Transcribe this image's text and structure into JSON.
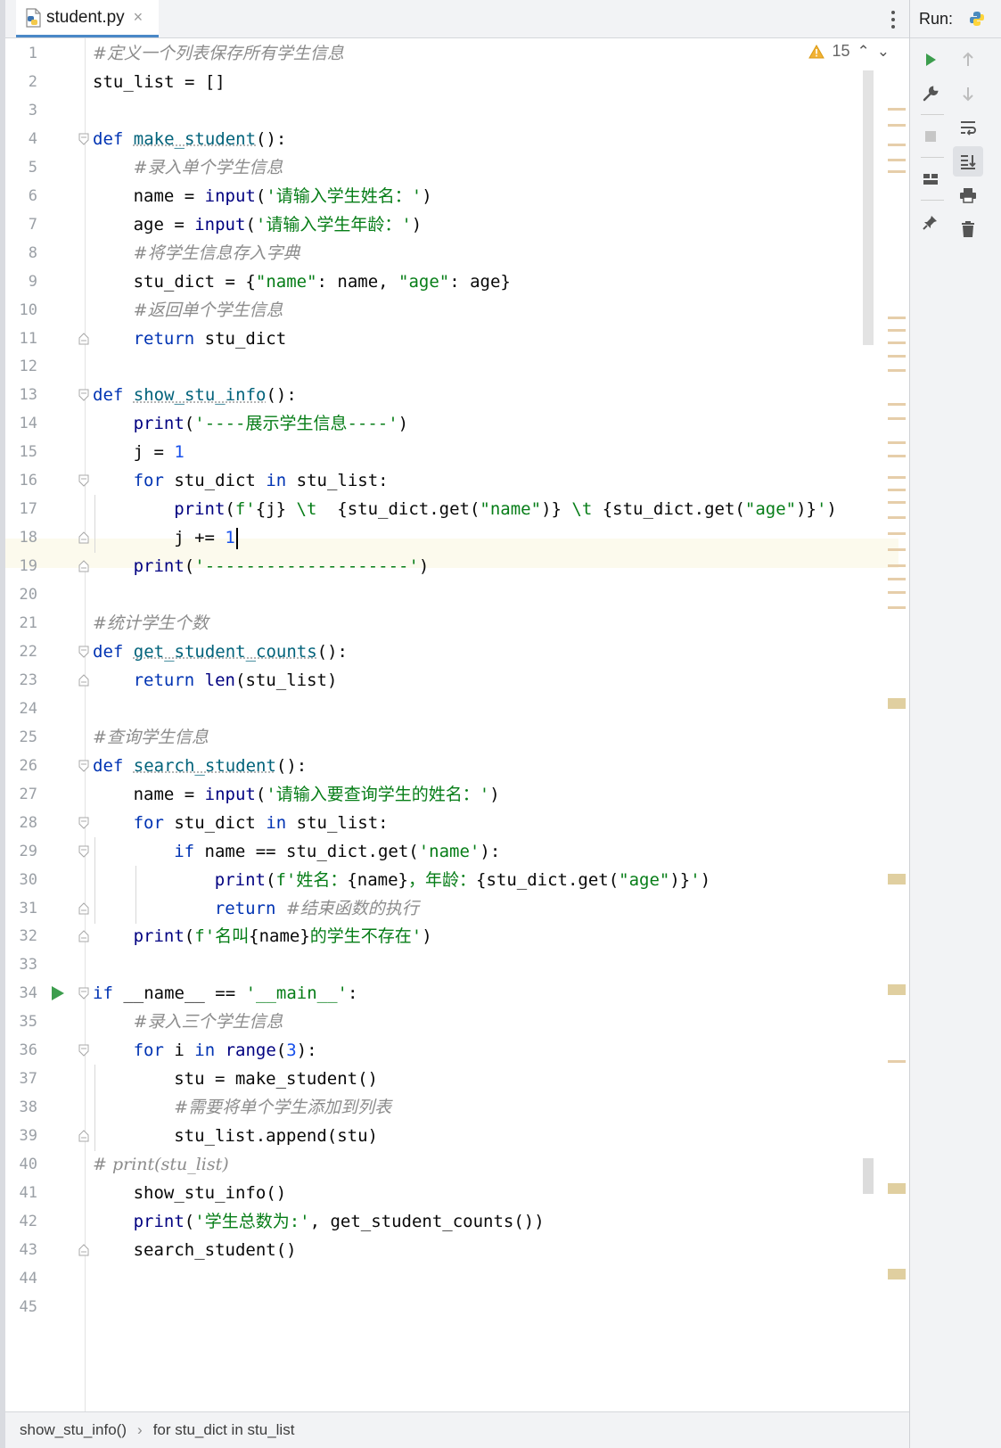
{
  "tab": {
    "filename": "student.py",
    "close_glyph": "×"
  },
  "run_panel": {
    "title": "Run:"
  },
  "inspections": {
    "warning_count": "15",
    "up_glyph": "⌃",
    "down_glyph": "⌄"
  },
  "breadcrumb": {
    "items": [
      "show_stu_info()",
      "for stu_dict in stu_list"
    ],
    "separator": "›"
  },
  "caret_line": 18,
  "colors": {
    "keyword": "#0033b3",
    "function": "#00627a",
    "string": "#067d17",
    "number": "#1750eb",
    "comment": "#8c8c8c",
    "run_green": "#3c9d4d",
    "caret_row": "#fcfaed"
  },
  "icons": [
    "python-file-icon",
    "warning-icon",
    "run-icon",
    "wrench-icon",
    "stop-icon",
    "layout-icon",
    "pin-icon",
    "arrow-up-icon",
    "arrow-down-icon",
    "soft-wrap-icon",
    "scroll-to-end-icon",
    "print-icon",
    "trash-icon",
    "fold-icon",
    "python-logo-icon"
  ],
  "lines": [
    {
      "n": 1,
      "indent": 0,
      "fold": "",
      "segs": [
        [
          "cmt",
          "#定义一个列表保存所有学生信息"
        ]
      ]
    },
    {
      "n": 2,
      "indent": 0,
      "fold": "",
      "segs": [
        [
          "plain",
          "stu_list = []"
        ]
      ]
    },
    {
      "n": 3,
      "indent": 0,
      "fold": "",
      "segs": []
    },
    {
      "n": 4,
      "indent": 0,
      "fold": "open",
      "segs": [
        [
          "kw",
          "def "
        ],
        [
          "fn",
          "make_student"
        ],
        [
          "plain",
          "():"
        ]
      ]
    },
    {
      "n": 5,
      "indent": 1,
      "fold": "",
      "segs": [
        [
          "cmt",
          "#录入单个学生信息"
        ]
      ]
    },
    {
      "n": 6,
      "indent": 1,
      "fold": "",
      "segs": [
        [
          "plain",
          "name = "
        ],
        [
          "bi",
          "input"
        ],
        [
          "plain",
          "("
        ],
        [
          "str",
          "'请输入学生姓名：'"
        ],
        [
          "plain",
          ")"
        ]
      ]
    },
    {
      "n": 7,
      "indent": 1,
      "fold": "",
      "segs": [
        [
          "plain",
          "age = "
        ],
        [
          "bi",
          "input"
        ],
        [
          "plain",
          "("
        ],
        [
          "str",
          "'请输入学生年龄：'"
        ],
        [
          "plain",
          ")"
        ]
      ]
    },
    {
      "n": 8,
      "indent": 1,
      "fold": "",
      "segs": [
        [
          "cmt",
          "#将学生信息存入字典"
        ]
      ]
    },
    {
      "n": 9,
      "indent": 1,
      "fold": "",
      "segs": [
        [
          "plain",
          "stu_dict = {"
        ],
        [
          "str",
          "\"name\""
        ],
        [
          "plain",
          ": name, "
        ],
        [
          "str",
          "\"age\""
        ],
        [
          "plain",
          ": age}"
        ]
      ]
    },
    {
      "n": 10,
      "indent": 1,
      "fold": "",
      "segs": [
        [
          "cmt",
          "#返回单个学生信息"
        ]
      ]
    },
    {
      "n": 11,
      "indent": 1,
      "fold": "close",
      "segs": [
        [
          "kw",
          "return "
        ],
        [
          "plain",
          "stu_dict"
        ]
      ]
    },
    {
      "n": 12,
      "indent": 0,
      "fold": "",
      "segs": []
    },
    {
      "n": 13,
      "indent": 0,
      "fold": "open",
      "segs": [
        [
          "kw",
          "def "
        ],
        [
          "fn",
          "show_stu_info"
        ],
        [
          "plain",
          "():"
        ]
      ]
    },
    {
      "n": 14,
      "indent": 1,
      "fold": "",
      "segs": [
        [
          "bi",
          "print"
        ],
        [
          "plain",
          "("
        ],
        [
          "str",
          "'----展示学生信息----'"
        ],
        [
          "plain",
          ")"
        ]
      ]
    },
    {
      "n": 15,
      "indent": 1,
      "fold": "",
      "segs": [
        [
          "plain",
          "j = "
        ],
        [
          "num",
          "1"
        ]
      ]
    },
    {
      "n": 16,
      "indent": 1,
      "fold": "open",
      "segs": [
        [
          "kw",
          "for "
        ],
        [
          "plain",
          "stu_dict "
        ],
        [
          "kw",
          "in "
        ],
        [
          "plain",
          "stu_list:"
        ]
      ]
    },
    {
      "n": 17,
      "indent": 2,
      "fold": "",
      "segs": [
        [
          "bi",
          "print"
        ],
        [
          "plain",
          "("
        ],
        [
          "str",
          "f'"
        ],
        [
          "plain",
          "{j}"
        ],
        [
          "str",
          " \\t  "
        ],
        [
          "plain",
          "{stu_dict.get("
        ],
        [
          "str",
          "\"name\""
        ],
        [
          "plain",
          ")}"
        ],
        [
          "str",
          " \\t "
        ],
        [
          "plain",
          "{stu_dict.get("
        ],
        [
          "str",
          "\"age\""
        ],
        [
          "plain",
          ")}"
        ],
        [
          "str",
          "'"
        ],
        [
          "plain",
          ")"
        ]
      ]
    },
    {
      "n": 18,
      "indent": 2,
      "fold": "close",
      "segs": [
        [
          "plain",
          "j += "
        ],
        [
          "num",
          "1"
        ]
      ]
    },
    {
      "n": 19,
      "indent": 1,
      "fold": "close",
      "segs": [
        [
          "bi",
          "print"
        ],
        [
          "plain",
          "("
        ],
        [
          "str",
          "'--------------------'"
        ],
        [
          "plain",
          ")"
        ]
      ]
    },
    {
      "n": 20,
      "indent": 0,
      "fold": "",
      "segs": []
    },
    {
      "n": 21,
      "indent": 0,
      "fold": "",
      "segs": [
        [
          "cmt",
          "#统计学生个数"
        ]
      ]
    },
    {
      "n": 22,
      "indent": 0,
      "fold": "open",
      "segs": [
        [
          "kw",
          "def "
        ],
        [
          "fn",
          "get_student_counts"
        ],
        [
          "plain",
          "():"
        ]
      ]
    },
    {
      "n": 23,
      "indent": 1,
      "fold": "close",
      "segs": [
        [
          "kw",
          "return "
        ],
        [
          "bi",
          "len"
        ],
        [
          "plain",
          "(stu_list)"
        ]
      ]
    },
    {
      "n": 24,
      "indent": 0,
      "fold": "",
      "segs": []
    },
    {
      "n": 25,
      "indent": 0,
      "fold": "",
      "segs": [
        [
          "cmt",
          "#查询学生信息"
        ]
      ]
    },
    {
      "n": 26,
      "indent": 0,
      "fold": "open",
      "segs": [
        [
          "kw",
          "def "
        ],
        [
          "fn",
          "search_student"
        ],
        [
          "plain",
          "():"
        ]
      ]
    },
    {
      "n": 27,
      "indent": 1,
      "fold": "",
      "segs": [
        [
          "plain",
          "name = "
        ],
        [
          "bi",
          "input"
        ],
        [
          "plain",
          "("
        ],
        [
          "str",
          "'请输入要查询学生的姓名：'"
        ],
        [
          "plain",
          ")"
        ]
      ]
    },
    {
      "n": 28,
      "indent": 1,
      "fold": "open",
      "segs": [
        [
          "kw",
          "for "
        ],
        [
          "plain",
          "stu_dict "
        ],
        [
          "kw",
          "in "
        ],
        [
          "plain",
          "stu_list:"
        ]
      ]
    },
    {
      "n": 29,
      "indent": 2,
      "fold": "open",
      "segs": [
        [
          "kw",
          "if "
        ],
        [
          "plain",
          "name == stu_dict.get("
        ],
        [
          "str",
          "'name'"
        ],
        [
          "plain",
          "):"
        ]
      ]
    },
    {
      "n": 30,
      "indent": 3,
      "fold": "",
      "segs": [
        [
          "bi",
          "print"
        ],
        [
          "plain",
          "("
        ],
        [
          "str",
          "f'姓名："
        ],
        [
          "plain",
          "{name}"
        ],
        [
          "str",
          "，年龄："
        ],
        [
          "plain",
          "{stu_dict.get("
        ],
        [
          "str",
          "\"age\""
        ],
        [
          "plain",
          ")}"
        ],
        [
          "str",
          "'"
        ],
        [
          "plain",
          ")"
        ]
      ]
    },
    {
      "n": 31,
      "indent": 3,
      "fold": "close",
      "segs": [
        [
          "kw",
          "return "
        ],
        [
          "cmt",
          "#结束函数的执行"
        ]
      ]
    },
    {
      "n": 32,
      "indent": 1,
      "fold": "close",
      "segs": [
        [
          "bi",
          "print"
        ],
        [
          "plain",
          "("
        ],
        [
          "str",
          "f'名叫"
        ],
        [
          "plain",
          "{name}"
        ],
        [
          "str",
          "的学生不存在'"
        ],
        [
          "plain",
          ")"
        ]
      ]
    },
    {
      "n": 33,
      "indent": 0,
      "fold": "",
      "segs": []
    },
    {
      "n": 34,
      "indent": 0,
      "fold": "open",
      "run": true,
      "segs": [
        [
          "kw",
          "if "
        ],
        [
          "plain",
          "__name__ == "
        ],
        [
          "str",
          "'__main__'"
        ],
        [
          "plain",
          ":"
        ]
      ]
    },
    {
      "n": 35,
      "indent": 1,
      "fold": "",
      "segs": [
        [
          "cmt",
          "#录入三个学生信息"
        ]
      ]
    },
    {
      "n": 36,
      "indent": 1,
      "fold": "open",
      "segs": [
        [
          "kw",
          "for "
        ],
        [
          "plain",
          "i "
        ],
        [
          "kw",
          "in "
        ],
        [
          "bi",
          "range"
        ],
        [
          "plain",
          "("
        ],
        [
          "num",
          "3"
        ],
        [
          "plain",
          "):"
        ]
      ]
    },
    {
      "n": 37,
      "indent": 2,
      "fold": "",
      "segs": [
        [
          "plain",
          "stu = make_student()"
        ]
      ]
    },
    {
      "n": 38,
      "indent": 2,
      "fold": "",
      "segs": [
        [
          "cmt",
          "#需要将单个学生添加到列表"
        ]
      ]
    },
    {
      "n": 39,
      "indent": 2,
      "fold": "close",
      "segs": [
        [
          "plain",
          "stu_list.append(stu)"
        ]
      ]
    },
    {
      "n": 40,
      "indent": 0,
      "fold": "",
      "segs": [
        [
          "cmt",
          "# print(stu_list)"
        ]
      ]
    },
    {
      "n": 41,
      "indent": 1,
      "fold": "",
      "segs": [
        [
          "plain",
          "show_stu_info()"
        ]
      ]
    },
    {
      "n": 42,
      "indent": 1,
      "fold": "",
      "segs": [
        [
          "bi",
          "print"
        ],
        [
          "plain",
          "("
        ],
        [
          "str",
          "'学生总数为:'"
        ],
        [
          "plain",
          ", get_student_counts())"
        ]
      ]
    },
    {
      "n": 43,
      "indent": 1,
      "fold": "close",
      "segs": [
        [
          "plain",
          "search_student()"
        ]
      ]
    },
    {
      "n": 44,
      "indent": 0,
      "fold": "",
      "segs": []
    },
    {
      "n": 45,
      "indent": 0,
      "fold": "",
      "segs": []
    }
  ]
}
